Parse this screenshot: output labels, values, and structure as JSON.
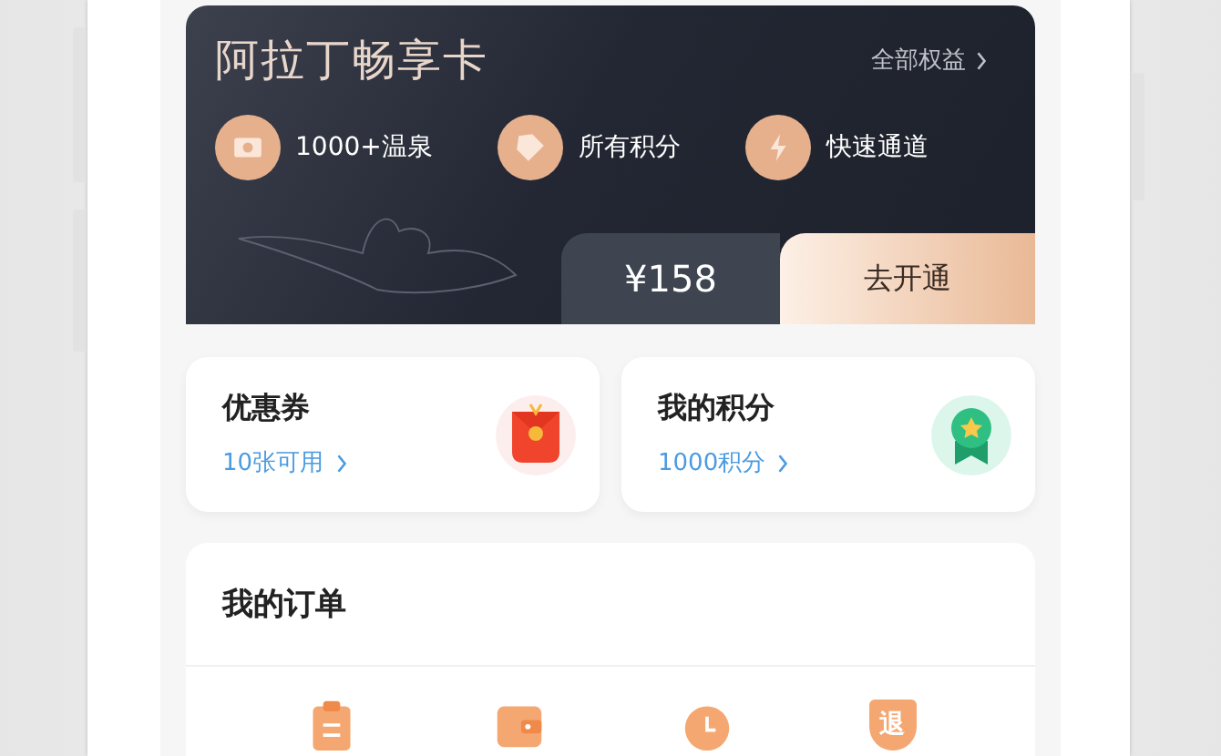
{
  "membership_card": {
    "title": "阿拉丁畅享卡",
    "all_benefits": "全部权益",
    "benefits": [
      {
        "kind": "photo",
        "label": "1000+温泉"
      },
      {
        "kind": "tag",
        "label": "所有积分"
      },
      {
        "kind": "bolt",
        "label": "快速通道"
      }
    ],
    "price": "¥158",
    "button": "去开通"
  },
  "tiles": [
    {
      "kind": "coupon",
      "title": "优惠券",
      "subtitle": "10张可用"
    },
    {
      "kind": "points",
      "title": "我的积分",
      "subtitle": "1000积分"
    }
  ],
  "orders": {
    "title": "我的订单",
    "items": [
      {
        "kind": "clipboard"
      },
      {
        "kind": "wallet"
      },
      {
        "kind": "clock"
      },
      {
        "kind": "refund",
        "glyph": "退"
      }
    ]
  }
}
